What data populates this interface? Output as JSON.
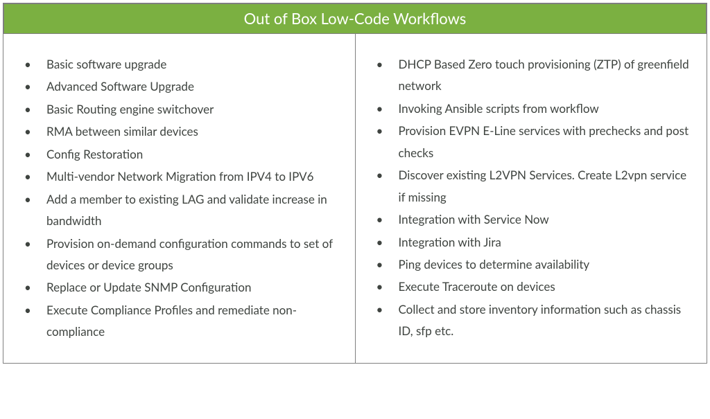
{
  "title": "Out of Box Low-Code Workflows",
  "left_items": [
    "Basic software upgrade",
    "Advanced Software Upgrade",
    "Basic Routing engine switchover",
    "RMA between similar devices",
    "Config Restoration",
    "Multi-vendor Network Migration from IPV4 to IPV6",
    "Add a member to existing LAG and validate increase in bandwidth",
    "Provision on-demand configuration commands to set of devices or device groups",
    "Replace or Update SNMP Configuration",
    "Execute Compliance Profiles and remediate non-compliance"
  ],
  "right_items": [
    "DHCP Based Zero touch provisioning (ZTP) of greenfield network",
    "Invoking Ansible scripts from workflow",
    "Provision EVPN E-Line services with prechecks and post checks",
    "Discover existing L2VPN Services. Create L2vpn service if missing",
    "Integration with Service Now",
    "Integration with Jira",
    "Ping devices to determine availability",
    "Execute Traceroute on devices",
    "Collect and store inventory information such as chassis ID, sfp etc."
  ]
}
